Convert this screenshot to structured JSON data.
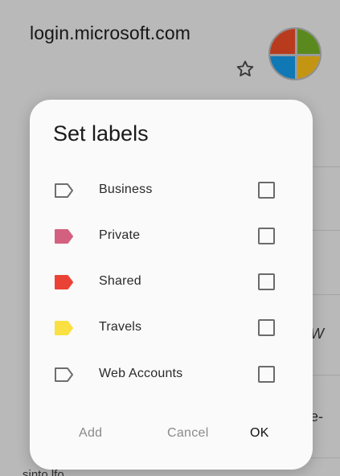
{
  "header": {
    "site": "login.microsoft.com"
  },
  "background": {
    "fragment_right_1": "W",
    "fragment_right_2": "e-",
    "bottom_text": "sinto.lfo..."
  },
  "dialog": {
    "title": "Set labels",
    "labels": [
      {
        "name": "Business",
        "color": "none",
        "checked": false
      },
      {
        "name": "Private",
        "color": "#d4607f",
        "checked": false
      },
      {
        "name": "Shared",
        "color": "#ea4335",
        "checked": false
      },
      {
        "name": "Travels",
        "color": "#fbe043",
        "checked": false
      },
      {
        "name": "Web Accounts",
        "color": "none",
        "checked": false
      }
    ],
    "buttons": {
      "add": "Add",
      "cancel": "Cancel",
      "ok": "OK"
    }
  }
}
